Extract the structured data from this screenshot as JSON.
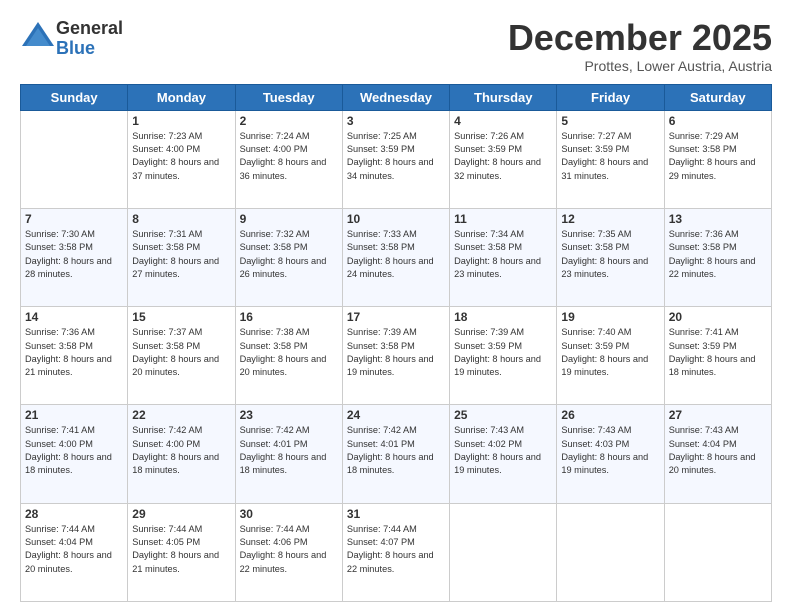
{
  "logo": {
    "general": "General",
    "blue": "Blue"
  },
  "title": "December 2025",
  "location": "Prottes, Lower Austria, Austria",
  "days_of_week": [
    "Sunday",
    "Monday",
    "Tuesday",
    "Wednesday",
    "Thursday",
    "Friday",
    "Saturday"
  ],
  "weeks": [
    [
      {
        "num": "",
        "sunrise": "",
        "sunset": "",
        "daylight": "",
        "empty": true
      },
      {
        "num": "1",
        "sunrise": "Sunrise: 7:23 AM",
        "sunset": "Sunset: 4:00 PM",
        "daylight": "Daylight: 8 hours and 37 minutes."
      },
      {
        "num": "2",
        "sunrise": "Sunrise: 7:24 AM",
        "sunset": "Sunset: 4:00 PM",
        "daylight": "Daylight: 8 hours and 36 minutes."
      },
      {
        "num": "3",
        "sunrise": "Sunrise: 7:25 AM",
        "sunset": "Sunset: 3:59 PM",
        "daylight": "Daylight: 8 hours and 34 minutes."
      },
      {
        "num": "4",
        "sunrise": "Sunrise: 7:26 AM",
        "sunset": "Sunset: 3:59 PM",
        "daylight": "Daylight: 8 hours and 32 minutes."
      },
      {
        "num": "5",
        "sunrise": "Sunrise: 7:27 AM",
        "sunset": "Sunset: 3:59 PM",
        "daylight": "Daylight: 8 hours and 31 minutes."
      },
      {
        "num": "6",
        "sunrise": "Sunrise: 7:29 AM",
        "sunset": "Sunset: 3:58 PM",
        "daylight": "Daylight: 8 hours and 29 minutes."
      }
    ],
    [
      {
        "num": "7",
        "sunrise": "Sunrise: 7:30 AM",
        "sunset": "Sunset: 3:58 PM",
        "daylight": "Daylight: 8 hours and 28 minutes."
      },
      {
        "num": "8",
        "sunrise": "Sunrise: 7:31 AM",
        "sunset": "Sunset: 3:58 PM",
        "daylight": "Daylight: 8 hours and 27 minutes."
      },
      {
        "num": "9",
        "sunrise": "Sunrise: 7:32 AM",
        "sunset": "Sunset: 3:58 PM",
        "daylight": "Daylight: 8 hours and 26 minutes."
      },
      {
        "num": "10",
        "sunrise": "Sunrise: 7:33 AM",
        "sunset": "Sunset: 3:58 PM",
        "daylight": "Daylight: 8 hours and 24 minutes."
      },
      {
        "num": "11",
        "sunrise": "Sunrise: 7:34 AM",
        "sunset": "Sunset: 3:58 PM",
        "daylight": "Daylight: 8 hours and 23 minutes."
      },
      {
        "num": "12",
        "sunrise": "Sunrise: 7:35 AM",
        "sunset": "Sunset: 3:58 PM",
        "daylight": "Daylight: 8 hours and 23 minutes."
      },
      {
        "num": "13",
        "sunrise": "Sunrise: 7:36 AM",
        "sunset": "Sunset: 3:58 PM",
        "daylight": "Daylight: 8 hours and 22 minutes."
      }
    ],
    [
      {
        "num": "14",
        "sunrise": "Sunrise: 7:36 AM",
        "sunset": "Sunset: 3:58 PM",
        "daylight": "Daylight: 8 hours and 21 minutes."
      },
      {
        "num": "15",
        "sunrise": "Sunrise: 7:37 AM",
        "sunset": "Sunset: 3:58 PM",
        "daylight": "Daylight: 8 hours and 20 minutes."
      },
      {
        "num": "16",
        "sunrise": "Sunrise: 7:38 AM",
        "sunset": "Sunset: 3:58 PM",
        "daylight": "Daylight: 8 hours and 20 minutes."
      },
      {
        "num": "17",
        "sunrise": "Sunrise: 7:39 AM",
        "sunset": "Sunset: 3:58 PM",
        "daylight": "Daylight: 8 hours and 19 minutes."
      },
      {
        "num": "18",
        "sunrise": "Sunrise: 7:39 AM",
        "sunset": "Sunset: 3:59 PM",
        "daylight": "Daylight: 8 hours and 19 minutes."
      },
      {
        "num": "19",
        "sunrise": "Sunrise: 7:40 AM",
        "sunset": "Sunset: 3:59 PM",
        "daylight": "Daylight: 8 hours and 19 minutes."
      },
      {
        "num": "20",
        "sunrise": "Sunrise: 7:41 AM",
        "sunset": "Sunset: 3:59 PM",
        "daylight": "Daylight: 8 hours and 18 minutes."
      }
    ],
    [
      {
        "num": "21",
        "sunrise": "Sunrise: 7:41 AM",
        "sunset": "Sunset: 4:00 PM",
        "daylight": "Daylight: 8 hours and 18 minutes."
      },
      {
        "num": "22",
        "sunrise": "Sunrise: 7:42 AM",
        "sunset": "Sunset: 4:00 PM",
        "daylight": "Daylight: 8 hours and 18 minutes."
      },
      {
        "num": "23",
        "sunrise": "Sunrise: 7:42 AM",
        "sunset": "Sunset: 4:01 PM",
        "daylight": "Daylight: 8 hours and 18 minutes."
      },
      {
        "num": "24",
        "sunrise": "Sunrise: 7:42 AM",
        "sunset": "Sunset: 4:01 PM",
        "daylight": "Daylight: 8 hours and 18 minutes."
      },
      {
        "num": "25",
        "sunrise": "Sunrise: 7:43 AM",
        "sunset": "Sunset: 4:02 PM",
        "daylight": "Daylight: 8 hours and 19 minutes."
      },
      {
        "num": "26",
        "sunrise": "Sunrise: 7:43 AM",
        "sunset": "Sunset: 4:03 PM",
        "daylight": "Daylight: 8 hours and 19 minutes."
      },
      {
        "num": "27",
        "sunrise": "Sunrise: 7:43 AM",
        "sunset": "Sunset: 4:04 PM",
        "daylight": "Daylight: 8 hours and 20 minutes."
      }
    ],
    [
      {
        "num": "28",
        "sunrise": "Sunrise: 7:44 AM",
        "sunset": "Sunset: 4:04 PM",
        "daylight": "Daylight: 8 hours and 20 minutes."
      },
      {
        "num": "29",
        "sunrise": "Sunrise: 7:44 AM",
        "sunset": "Sunset: 4:05 PM",
        "daylight": "Daylight: 8 hours and 21 minutes."
      },
      {
        "num": "30",
        "sunrise": "Sunrise: 7:44 AM",
        "sunset": "Sunset: 4:06 PM",
        "daylight": "Daylight: 8 hours and 22 minutes."
      },
      {
        "num": "31",
        "sunrise": "Sunrise: 7:44 AM",
        "sunset": "Sunset: 4:07 PM",
        "daylight": "Daylight: 8 hours and 22 minutes."
      },
      {
        "num": "",
        "sunrise": "",
        "sunset": "",
        "daylight": "",
        "empty": true
      },
      {
        "num": "",
        "sunrise": "",
        "sunset": "",
        "daylight": "",
        "empty": true
      },
      {
        "num": "",
        "sunrise": "",
        "sunset": "",
        "daylight": "",
        "empty": true
      }
    ]
  ]
}
